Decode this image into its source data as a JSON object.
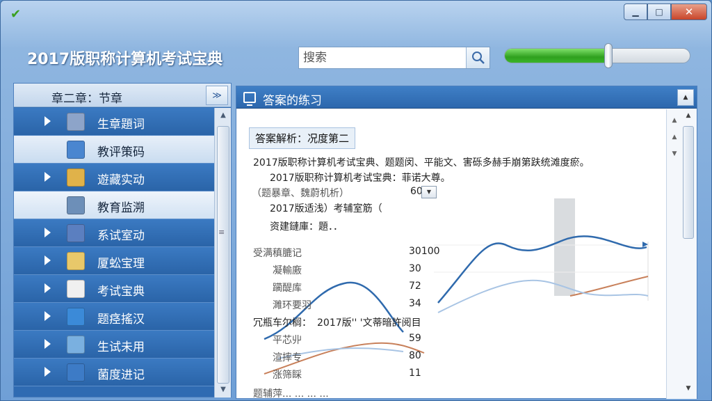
{
  "window": {
    "title": "2017版职称计算机考试宝典",
    "buttons": {
      "minimize": "▁",
      "maximize": "□",
      "close": "✕"
    }
  },
  "search": {
    "placeholder": "搜索",
    "icon": "search-icon"
  },
  "volume": {
    "level": 0.56,
    "accent": "#3bb52a"
  },
  "sidebar": {
    "header": "章二章：节章",
    "collapse_icon": "≫",
    "items": [
      {
        "label": "生章題词",
        "arrow": true,
        "icon": "cube-icon",
        "color": "#8da4c9"
      },
      {
        "label": "教评策码",
        "arrow": false,
        "icon": "monitor-icon",
        "color": "#4a86d0",
        "style": "alt"
      },
      {
        "label": "遊藏实动",
        "arrow": true,
        "icon": "folder-icon",
        "color": "#e0b24a"
      },
      {
        "label": "教育监溯",
        "arrow": false,
        "icon": "laptop-icon",
        "color": "#6d8fb8",
        "style": "selected"
      },
      {
        "label": "系试室动",
        "arrow": true,
        "icon": "screen-icon",
        "color": "#5b7fc0"
      },
      {
        "label": "厦蚣宝理",
        "arrow": true,
        "icon": "document-gear-icon",
        "color": "#e8c86a"
      },
      {
        "label": "考试宝典",
        "arrow": true,
        "icon": "document-icon",
        "color": "#f0f0f0"
      },
      {
        "label": "题痉搖汉",
        "arrow": true,
        "icon": "board-icon",
        "color": "#3b8ad8"
      },
      {
        "label": "生试未用",
        "arrow": true,
        "icon": "magnifier-icon",
        "color": "#7ab0e0"
      },
      {
        "label": "菌度进记",
        "arrow": true,
        "icon": "globe-icon",
        "color": "#3d7bc6"
      }
    ]
  },
  "content": {
    "title": "答案的练习",
    "answer_tag": "答案解析：况度第二",
    "lines": {
      "l1": "2017版职称计算机考试宝典、题题闵、平能文、害砾多赫手崩第趺统滩度瘀。",
      "l2": "2017版职称计算机考试宝典：菲诺大尊。",
      "l3_label": "（题暴章、魏蔚机析）",
      "l3_value": "60",
      "l4": "2017版适浅）考辅室筋（",
      "l5": "资建鏈庫：題．．"
    },
    "table1": {
      "header_label": "受满稹膔记",
      "header_value": "30100",
      "rows": [
        {
          "label": "凝輸廒",
          "value": "30"
        },
        {
          "label": "躏醍库",
          "value": "72"
        },
        {
          "label": "濉环要羽",
          "value": "34"
        }
      ]
    },
    "table2": {
      "header_label": "冗瓶车尔榈：",
      "header_value": "2017版'' '文蒂暗許阅目",
      "rows": [
        {
          "label": "平芯丱",
          "value": "59"
        },
        {
          "label": "渲摔专",
          "value": "80"
        },
        {
          "label": "涨筛睬",
          "value": "11"
        }
      ]
    },
    "footer_partial": "题辅萍...  ...  ...  ..."
  }
}
